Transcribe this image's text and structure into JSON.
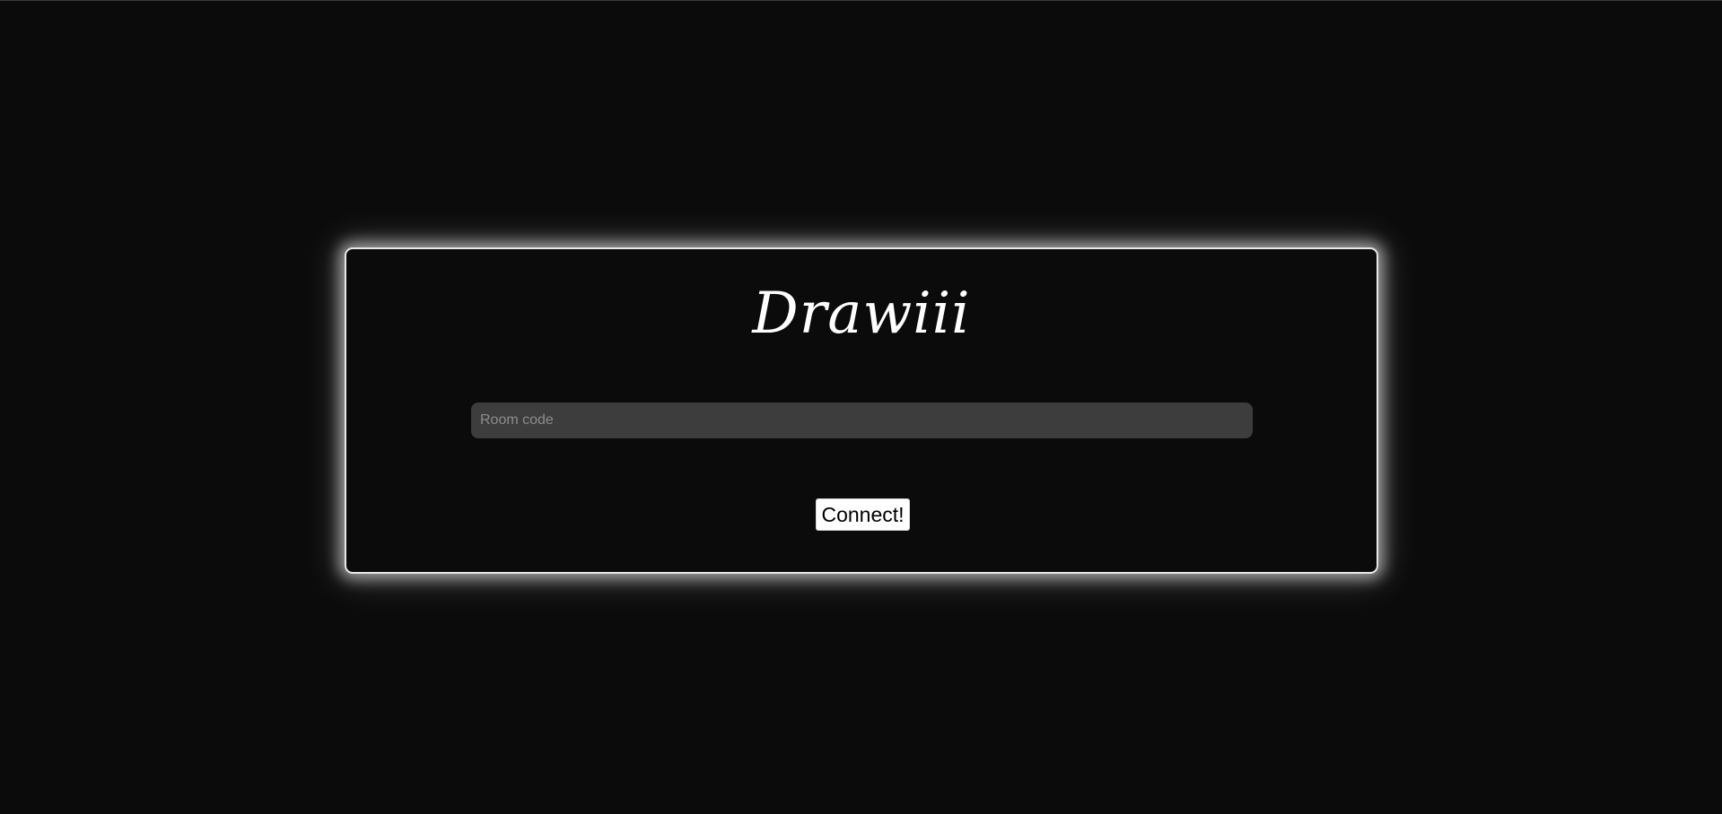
{
  "app": {
    "title": "Drawiii"
  },
  "form": {
    "room_code_placeholder": "Room code",
    "room_code_value": "",
    "connect_label": "Connect!"
  },
  "colors": {
    "background": "#0b0b0b",
    "card_border": "#e8e8e8",
    "input_background": "#3d3d3d",
    "button_background": "#ffffff",
    "text": "#ffffff"
  }
}
